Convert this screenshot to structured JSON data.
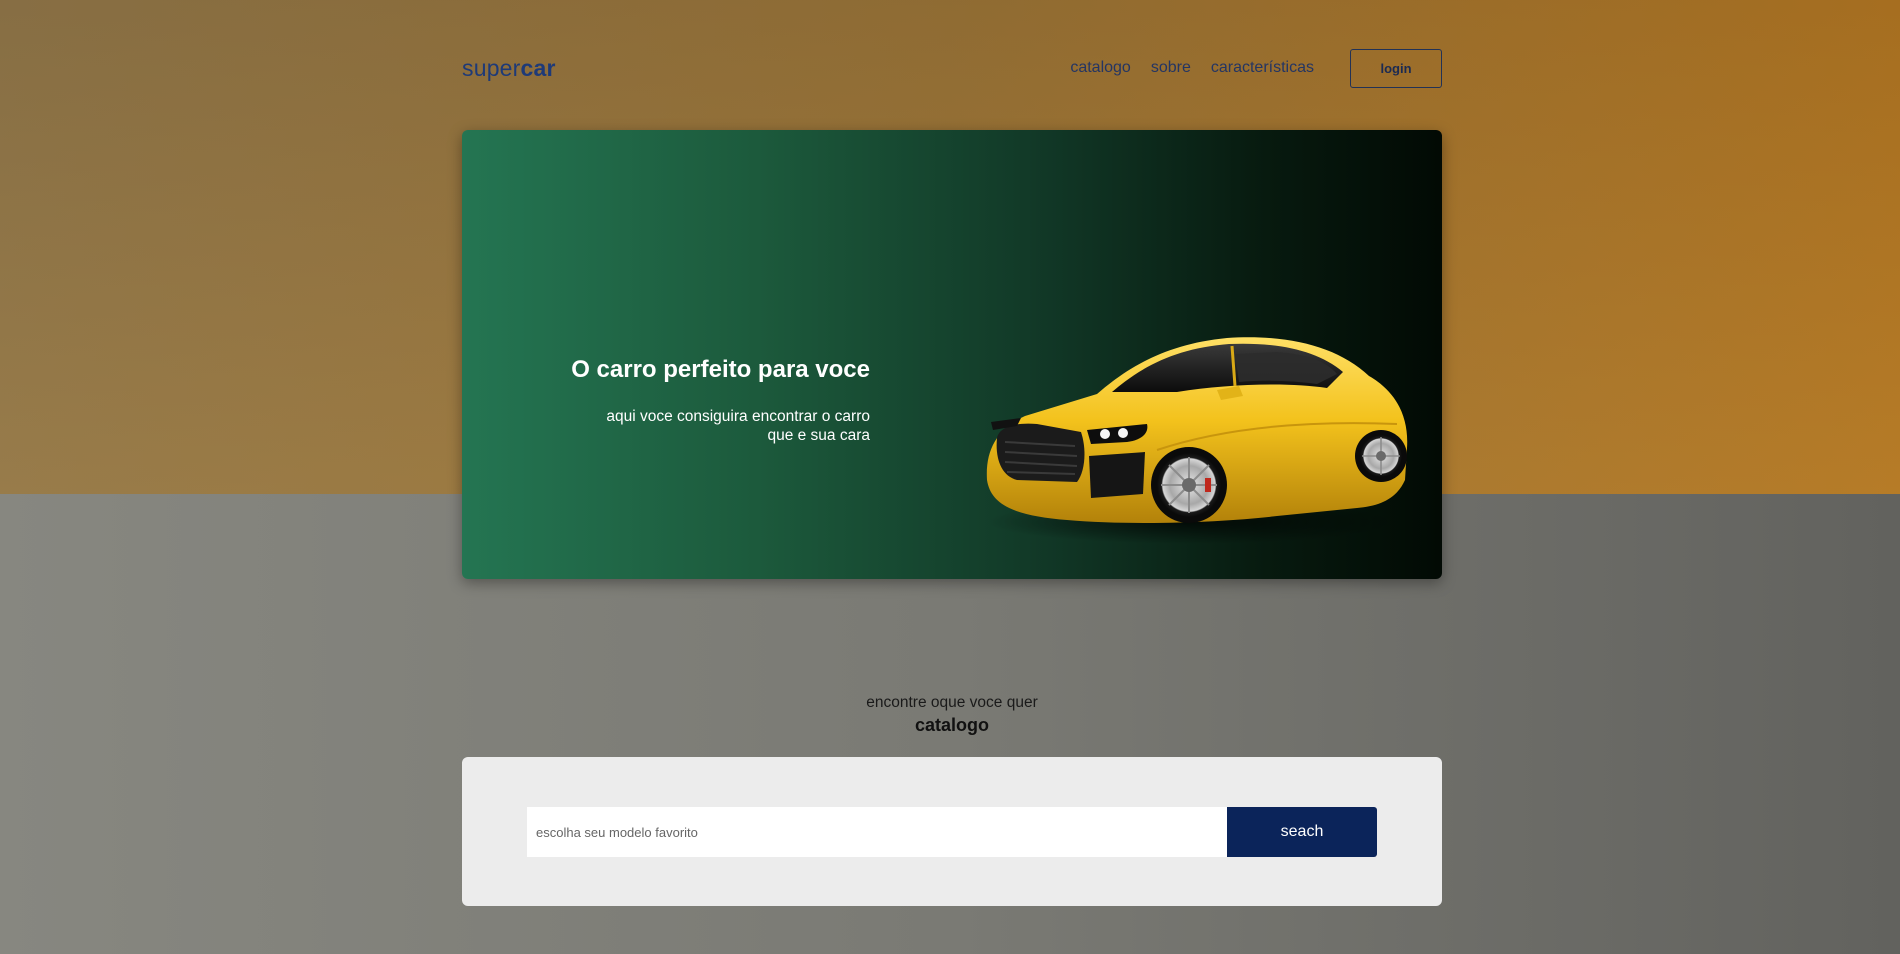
{
  "header": {
    "logo_light": "super",
    "logo_bold": "car",
    "nav": [
      "catalogo",
      "sobre",
      "características"
    ],
    "login_label": "login"
  },
  "hero": {
    "title": "O carro perfeito para voce",
    "subtitle_line1": "aqui voce consiguira encontrar o carro",
    "subtitle_line2": "que e sua cara"
  },
  "catalog": {
    "subtitle": "encontre oque voce quer",
    "title": "catalogo",
    "search_placeholder": "escolha seu modelo favorito",
    "search_button": "seach"
  },
  "colors": {
    "top_band": "#987236",
    "hero_green": "#247552",
    "button_navy": "#0b245a",
    "car_yellow": "#f3c21c"
  }
}
